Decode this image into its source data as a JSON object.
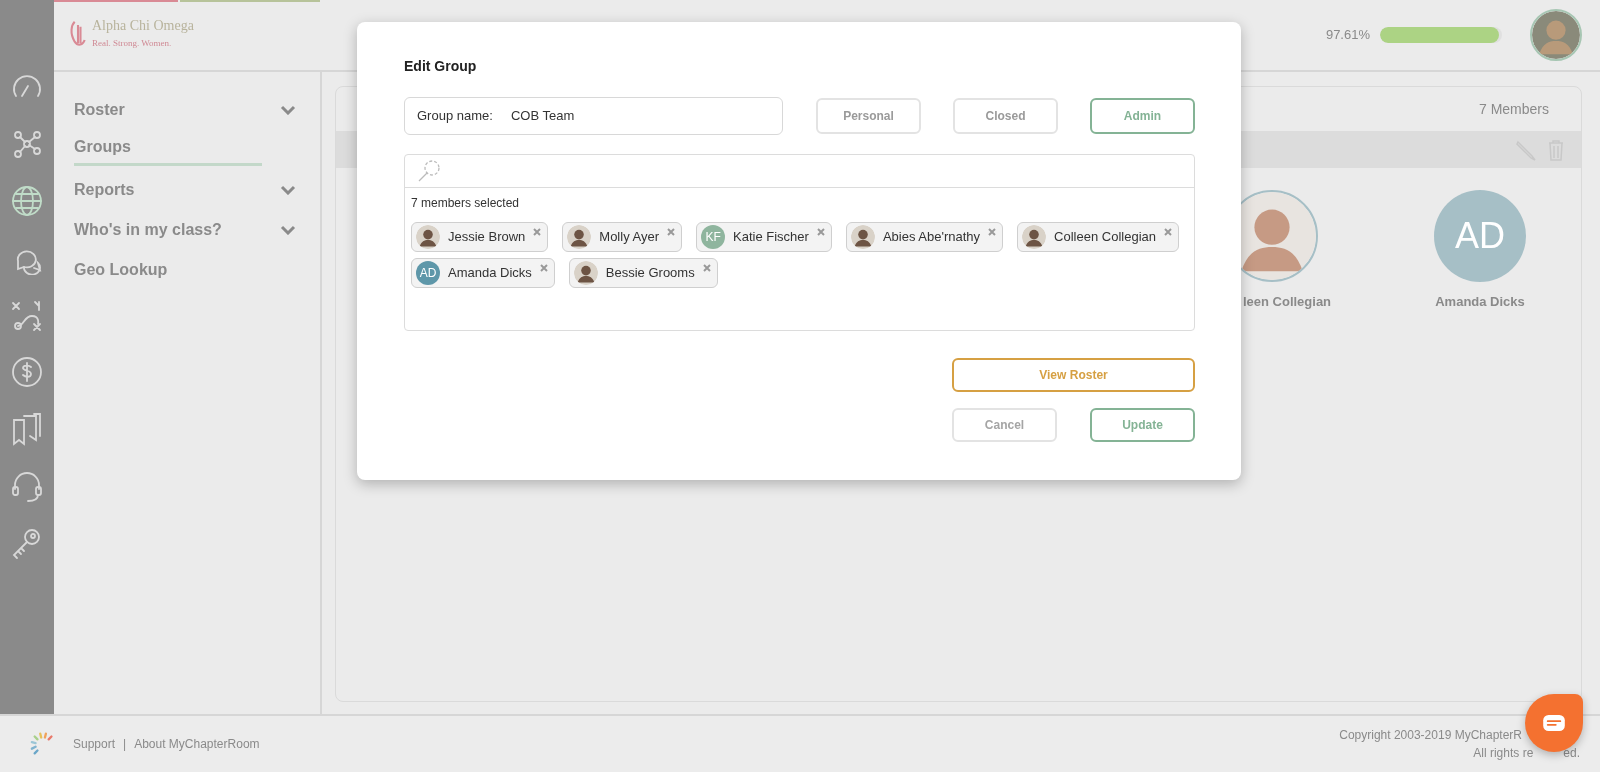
{
  "brand": {
    "name": "Alpha Chi Omega",
    "tagline": "Real. Strong. Women."
  },
  "rail_icons": [
    {
      "kind": "gauge",
      "selected": false
    },
    {
      "kind": "network",
      "selected": false
    },
    {
      "kind": "globe",
      "selected": true
    },
    {
      "kind": "chat",
      "selected": false
    },
    {
      "kind": "play",
      "selected": false
    },
    {
      "kind": "dollar",
      "selected": false
    },
    {
      "kind": "bookmarks",
      "selected": false
    },
    {
      "kind": "headset",
      "selected": false
    },
    {
      "kind": "key",
      "selected": false
    }
  ],
  "progress": {
    "reading": "97.61%",
    "level": 0.9761
  },
  "sidebar": {
    "items": [
      {
        "label": "Roster",
        "expandable": true,
        "selected": false
      },
      {
        "label": "Groups",
        "expandable": false,
        "selected": true
      },
      {
        "label": "Reports",
        "expandable": true,
        "selected": false
      },
      {
        "label": "Who's in my class?",
        "expandable": true,
        "selected": false
      },
      {
        "label": "Geo Lookup",
        "expandable": false,
        "selected": false
      }
    ]
  },
  "group_panel": {
    "member_count": "7 Members",
    "members": [
      {
        "name": "leen Collegian",
        "kind": "photo"
      },
      {
        "name": "Amanda Dicks",
        "kind": "initials",
        "initials": "AD",
        "color": "#a6bfc6"
      }
    ]
  },
  "modal": {
    "title": "Edit Group",
    "group_name_label": "Group name:",
    "group_name": "COB Team",
    "toggles": [
      {
        "label": "Personal",
        "selected": false
      },
      {
        "label": "Closed",
        "selected": false
      },
      {
        "label": "Admin",
        "selected": true
      }
    ],
    "selected_count": "7 members selected",
    "chips": [
      {
        "name": "Jessie Brown",
        "kind": "photo"
      },
      {
        "name": "Molly Ayer",
        "kind": "photo"
      },
      {
        "name": "Katie Fischer",
        "kind": "initials",
        "initials": "KF",
        "color": "#8fb59e"
      },
      {
        "name": "Abies Abe'rnathy",
        "kind": "photo"
      },
      {
        "name": "Colleen Collegian",
        "kind": "photo"
      },
      {
        "name": "Amanda Dicks",
        "kind": "initials",
        "initials": "AD",
        "color": "#5e97a9"
      },
      {
        "name": "Bessie Grooms",
        "kind": "photo"
      }
    ],
    "buttons": [
      {
        "label": "View Roster",
        "kind": "roster"
      },
      {
        "label": "Cancel",
        "kind": "cancel"
      },
      {
        "label": "Update",
        "kind": "update"
      }
    ]
  },
  "footer": {
    "links": [
      "Support",
      "About MyChapterRoom"
    ],
    "separator": "|",
    "copyright": "Copyright 2003-2019 MyChapterR",
    "rights": [
      "All rights re",
      "ed."
    ]
  }
}
